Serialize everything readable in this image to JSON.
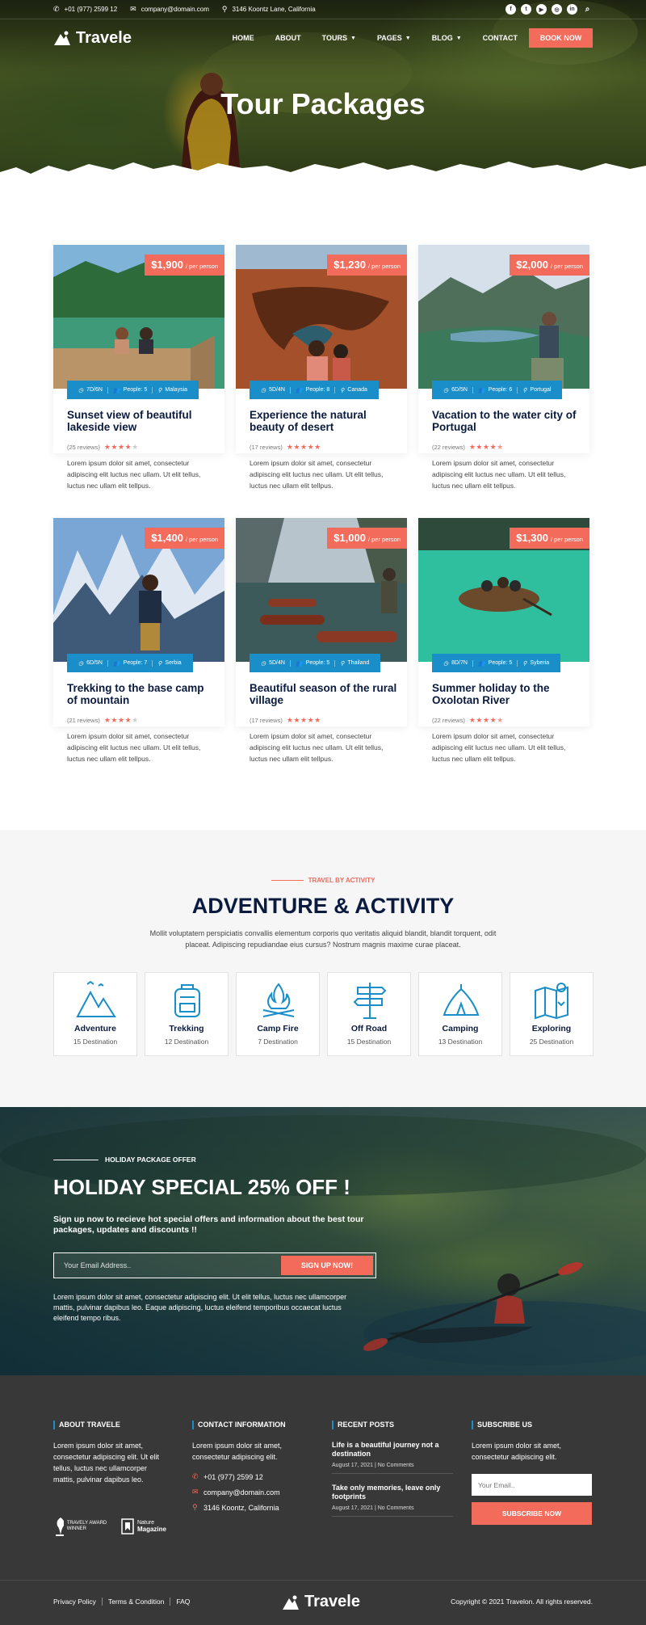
{
  "topbar": {
    "phone": "+01 (977) 2599 12",
    "email": "company@domain.com",
    "address": "3146 Koontz Lane, California",
    "social": [
      "facebook-icon",
      "twitter-icon",
      "youtube-icon",
      "instagram-icon",
      "linkedin-icon",
      "search-icon"
    ]
  },
  "nav": {
    "logo": "Travele",
    "items": [
      {
        "label": "HOME",
        "dropdown": false
      },
      {
        "label": "ABOUT",
        "dropdown": false
      },
      {
        "label": "TOURS",
        "dropdown": true
      },
      {
        "label": "PAGES",
        "dropdown": true
      },
      {
        "label": "BLOG",
        "dropdown": true
      },
      {
        "label": "CONTACT",
        "dropdown": false
      }
    ],
    "book_now": "BOOK NOW"
  },
  "hero": {
    "title": "Tour Packages"
  },
  "tours": [
    {
      "price": "$1,900",
      "per": "/ per person",
      "duration": "7D/6N",
      "people": "People: 5",
      "location": "Malaysia",
      "title": "Sunset view of beautiful lakeside view",
      "reviews": "(25 reviews)",
      "rating": 4,
      "text": "Lorem ipsum dolor sit amet, consectetur adipiscing elit luctus nec ullam. Ut elit tellus, luctus nec ullam elit tellpus."
    },
    {
      "price": "$1,230",
      "per": "/ per person",
      "duration": "5D/4N",
      "people": "People: 8",
      "location": "Canada",
      "title": "Experience the natural beauty of desert",
      "reviews": "(17 reviews)",
      "rating": 5,
      "text": "Lorem ipsum dolor sit amet, consectetur adipiscing elit luctus nec ullam. Ut elit tellus, luctus nec ullam elit tellpus."
    },
    {
      "price": "$2,000",
      "per": "/ per person",
      "duration": "6D/5N",
      "people": "People: 6",
      "location": "Portugal",
      "title": "Vacation to the water city of Portugal",
      "reviews": "(22 reviews)",
      "rating": 4.5,
      "text": "Lorem ipsum dolor sit amet, consectetur adipiscing elit luctus nec ullam. Ut elit tellus, luctus nec ullam elit tellpus."
    },
    {
      "price": "$1,400",
      "per": "/ per person",
      "duration": "6D/5N",
      "people": "People: 7",
      "location": "Serbia",
      "title": "Trekking to the base camp of mountain",
      "reviews": "(21 reviews)",
      "rating": 4,
      "text": "Lorem ipsum dolor sit amet, consectetur adipiscing elit luctus nec ullam. Ut elit tellus, luctus nec ullam elit tellpus."
    },
    {
      "price": "$1,000",
      "per": "/ per person",
      "duration": "5D/4N",
      "people": "People: 5",
      "location": "Thailand",
      "title": "Beautiful season of the rural village",
      "reviews": "(17 reviews)",
      "rating": 5,
      "text": "Lorem ipsum dolor sit amet, consectetur adipiscing elit luctus nec ullam. Ut elit tellus, luctus nec ullam elit tellpus."
    },
    {
      "price": "$1,300",
      "per": "/ per person",
      "duration": "8D/7N",
      "people": "People: 5",
      "location": "Syberia",
      "title": "Summer holiday to the Oxolotan River",
      "reviews": "(22 reviews)",
      "rating": 4.5,
      "text": "Lorem ipsum dolor sit amet, consectetur adipiscing elit luctus nec ullam. Ut elit tellus, luctus nec ullam elit tellpus."
    }
  ],
  "activity": {
    "label": "TRAVEL BY ACTIVITY",
    "title": "ADVENTURE & ACTIVITY",
    "desc": "Mollit voluptatem perspiciatis convallis elementum corporis quo veritatis aliquid blandit, blandit torquent, odit placeat. Adipiscing repudiandae eius cursus? Nostrum magnis maxime curae placeat.",
    "items": [
      {
        "name": "Adventure",
        "count": "15 Destination",
        "icon": "mountain-icon"
      },
      {
        "name": "Trekking",
        "count": "12 Destination",
        "icon": "backpack-icon"
      },
      {
        "name": "Camp Fire",
        "count": "7 Destination",
        "icon": "campfire-icon"
      },
      {
        "name": "Off Road",
        "count": "15 Destination",
        "icon": "signpost-icon"
      },
      {
        "name": "Camping",
        "count": "13 Destination",
        "icon": "tent-icon"
      },
      {
        "name": "Exploring",
        "count": "25 Destination",
        "icon": "map-icon"
      }
    ]
  },
  "holiday": {
    "label": "HOLIDAY PACKAGE OFFER",
    "title": "HOLIDAY SPECIAL 25% OFF !",
    "sub": "Sign up now to recieve hot special offers and information about the best tour packages, updates and discounts !!",
    "placeholder": "Your Email Address..",
    "button": "SIGN UP NOW!",
    "text": "Lorem ipsum dolor sit amet, consectetur adipiscing elit. Ut elit tellus, luctus nec ullamcorper mattis, pulvinar dapibus leo. Eaque adipiscing, luctus eleifend temporibus occaecat luctus eleifend tempo ribus."
  },
  "footer": {
    "about": {
      "head": "ABOUT TRAVELE",
      "text": "Lorem ipsum dolor sit amet, consectetur adipiscing elit. Ut elit tellus, luctus nec ullamcorper mattis, pulvinar dapibus leo.",
      "award1": "TRAVELY AWARD WINNER",
      "award2_a": "Nature",
      "award2_b": "Magazine"
    },
    "contact": {
      "head": "CONTACT INFORMATION",
      "text": "Lorem ipsum dolor sit amet, consectetur adipiscing elit.",
      "phone": "+01 (977) 2599 12",
      "email": "company@domain.com",
      "address": "3146 Koontz, California"
    },
    "posts": {
      "head": "RECENT POSTS",
      "items": [
        {
          "title": "Life is a beautiful journey not a destination",
          "date": "August 17, 2021",
          "comments": "No Comments"
        },
        {
          "title": "Take only memories, leave only footprints",
          "date": "August 17, 2021",
          "comments": "No Comments"
        }
      ]
    },
    "subscribe": {
      "head": "SUBSCRIBE US",
      "text": "Lorem ipsum dolor sit amet, consectetur adipiscing elit.",
      "placeholder": "Your Email..",
      "button": "SUBSCRIBE NOW"
    }
  },
  "bottom": {
    "links": [
      "Privacy Policy",
      "Terms & Condition",
      "FAQ"
    ],
    "logo": "Travele",
    "copyright": "Copyright © 2021 Travelon. All rights reserved."
  },
  "colors": {
    "accent": "#f26b5b",
    "blue": "#1a8ec8",
    "navy": "#0b1b3f",
    "footer": "#383839"
  }
}
